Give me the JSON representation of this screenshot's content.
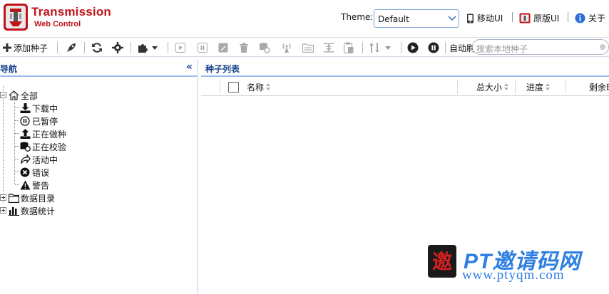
{
  "header": {
    "brand_title": "Transmission",
    "brand_subtitle": "Web Control",
    "theme_label": "Theme:",
    "theme_value": "Default",
    "links": [
      {
        "label": "移动UI",
        "icon": "mobile-icon"
      },
      {
        "label": "原版UI",
        "icon": "original-ui-icon"
      },
      {
        "label": "关于",
        "icon": "info-icon"
      }
    ]
  },
  "toolbar": {
    "add_torrent_label": "添加种子",
    "auto_refresh_label": "自动刷",
    "search_placeholder": "搜索本地种子"
  },
  "nav": {
    "title": "导航",
    "collapse_label": "«",
    "items": [
      {
        "label": "全部",
        "icon": "home-icon"
      },
      {
        "label": "下载中",
        "icon": "download-icon"
      },
      {
        "label": "已暂停",
        "icon": "pause-icon"
      },
      {
        "label": "正在做种",
        "icon": "upload-icon"
      },
      {
        "label": "正在校验",
        "icon": "verify-icon"
      },
      {
        "label": "活动中",
        "icon": "active-icon"
      },
      {
        "label": "错误",
        "icon": "error-icon"
      },
      {
        "label": "警告",
        "icon": "warning-icon"
      },
      {
        "label": "数据目录",
        "icon": "folder-icon"
      },
      {
        "label": "数据统计",
        "icon": "stats-icon"
      }
    ]
  },
  "main": {
    "title": "种子列表",
    "columns": [
      "名称",
      "总大小",
      "进度",
      "剩余时"
    ]
  },
  "watermark": {
    "badge_char": "邀",
    "title": "PT邀请码网",
    "url": "www.ptyqm.com"
  },
  "colors": {
    "brand_red": "#c0131a",
    "nav_blue": "#15428b",
    "panel_border": "#99bbe8",
    "watermark_blue": "#2f7fe3"
  }
}
